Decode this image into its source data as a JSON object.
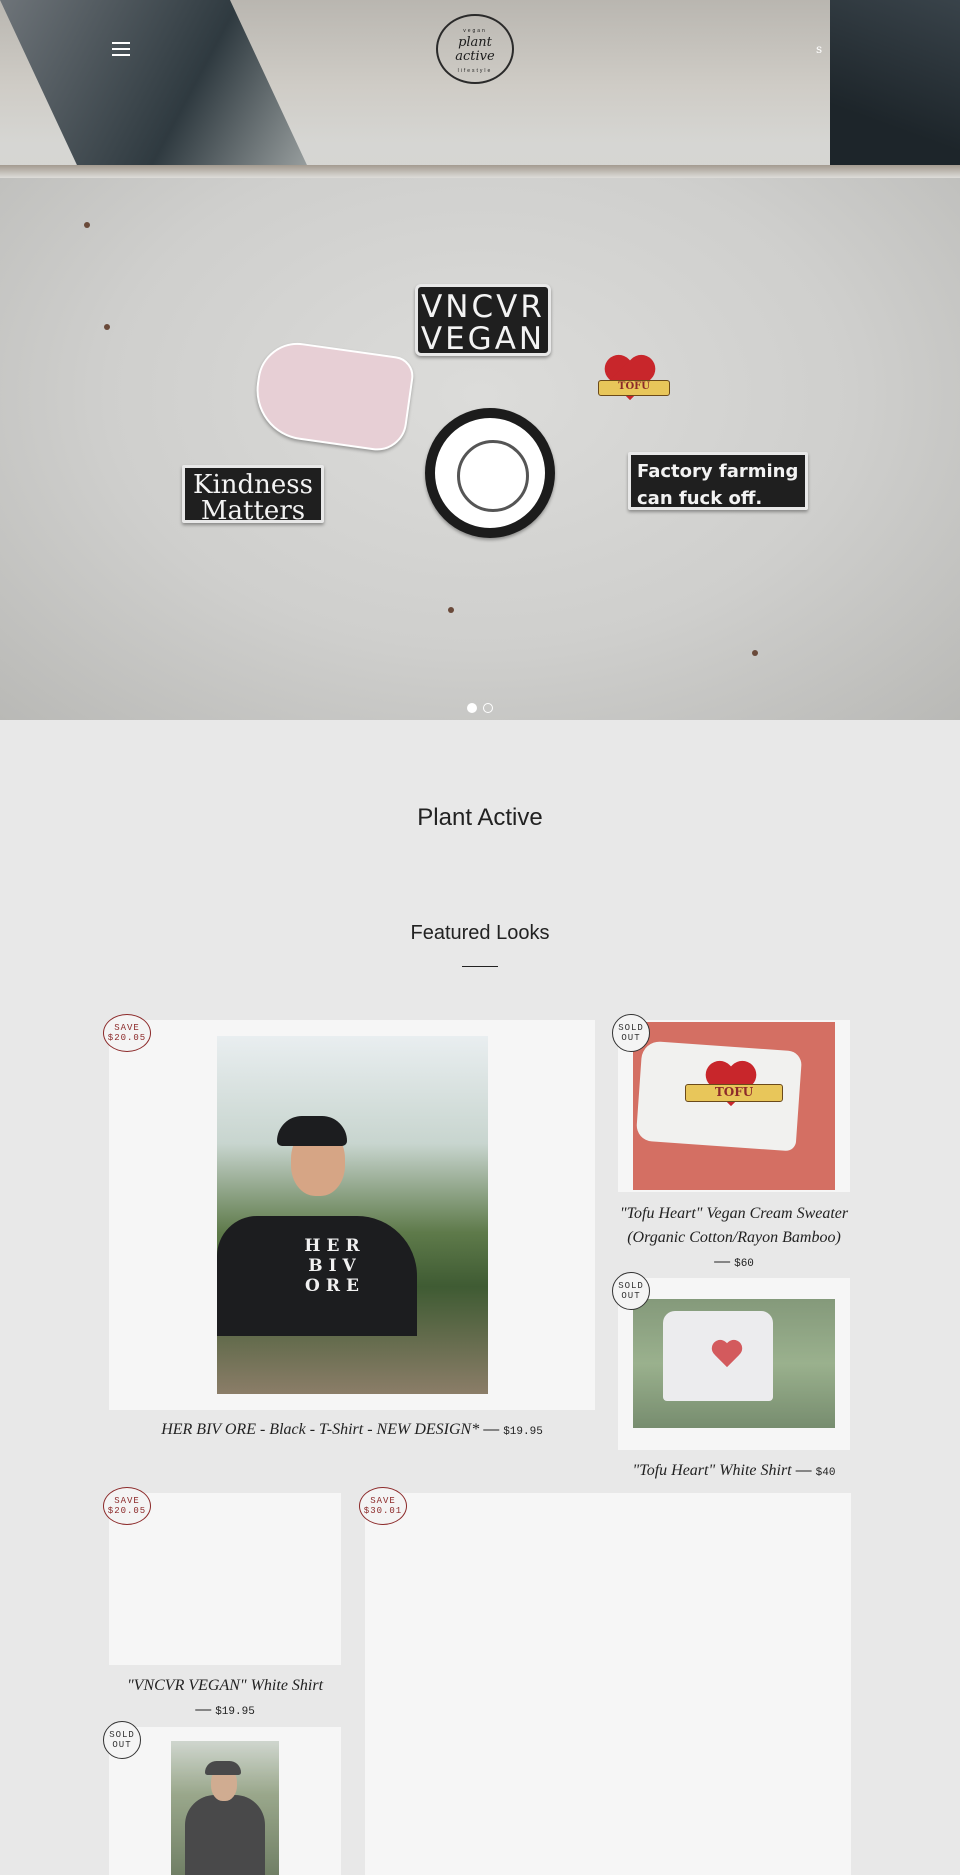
{
  "header": {
    "menu_icon": "hamburger-menu-icon",
    "logo": {
      "top": "vegan",
      "main": "plant active",
      "bottom": "lifestyle"
    },
    "cart_label": "s"
  },
  "hero": {
    "stickers": {
      "vegan": "VNCVR VEGAN",
      "kindness": "Kindness Matters",
      "factory": "Factory farming can fuck off.",
      "tofu": "TOFU"
    },
    "slide_count": 2,
    "active_slide": 1
  },
  "site": {
    "title": "Plant Active"
  },
  "featured": {
    "heading": "Featured Looks",
    "products": [
      {
        "title": "HER BIV ORE - Black - T-Shirt - NEW DESIGN*",
        "price": "$19.95",
        "badge": [
          "SAVE",
          "$20.05"
        ],
        "shirt_text": "HER BIV ORE"
      },
      {
        "title": "\"Tofu Heart\" Vegan Cream Sweater (Organic Cotton/Rayon Bamboo)",
        "price": "$60",
        "badge": [
          "SOLD",
          "OUT"
        ],
        "banner": "TOFU"
      },
      {
        "title": "\"Tofu Heart\" White Shirt",
        "price": "$40",
        "badge": [
          "SOLD",
          "OUT"
        ]
      },
      {
        "title": "\"VNCVR VEGAN\" White Shirt",
        "price": "$19.95",
        "badge": [
          "SAVE",
          "$20.05"
        ]
      },
      {
        "title": "",
        "price": "",
        "badge": [
          "SAVE",
          "$30.01"
        ]
      },
      {
        "title": "",
        "price": "",
        "badge": [
          "SOLD",
          "OUT"
        ]
      }
    ]
  },
  "colors": {
    "page_bg": "#e8e8e8",
    "card_bg": "#f6f6f6",
    "save_badge": "#8c2a2a",
    "sold_badge": "#333333"
  }
}
